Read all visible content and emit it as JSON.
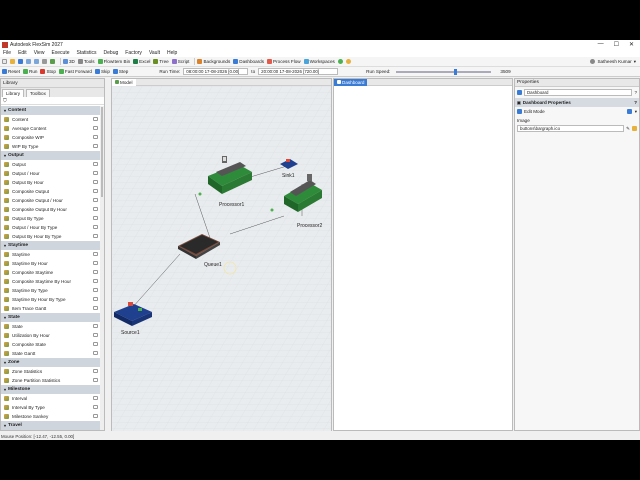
{
  "app": {
    "title": "Autodesk FlexSim 2027"
  },
  "window": {
    "minimize": "—",
    "maximize": "☐",
    "close": "✕"
  },
  "menu": [
    "File",
    "Edit",
    "View",
    "Execute",
    "Statistics",
    "Debug",
    "Factory",
    "Vault",
    "Help"
  ],
  "toolbar": {
    "items": [
      "3D",
      "Tools",
      "FlowItem Bin",
      "Excel",
      "Tree",
      "Script",
      "Backgrounds",
      "Dashboards",
      "Process Flow",
      "Workspaces"
    ],
    "user": "Satheesh Kumar"
  },
  "runbar": {
    "reset": "Reset",
    "run": "Run",
    "stop": "Stop",
    "fast_forward": "Fast Forward",
    "skip": "Skip",
    "step": "Step",
    "run_time_label": "Run Time:",
    "start_value": "08:00:00  17-08-2026  [0.00]",
    "to_label": "to",
    "end_value": "20:00:00  17-08-2026  [720.00]",
    "speed_label": "Run Speed:",
    "speed_value": "3509"
  },
  "library": {
    "title": "Library",
    "tabs": [
      "Library",
      "Toolbox"
    ],
    "filter_icon": "filter-icon",
    "categories": [
      {
        "name": "Content",
        "items": [
          "Content",
          "Average Content",
          "Composite WIP",
          "WIP By Type"
        ]
      },
      {
        "name": "Output",
        "items": [
          "Output",
          "Output / Hour",
          "Output By Hour",
          "Composite Output",
          "Composite Output / Hour",
          "Composite Output By Hour",
          "Output By Type",
          "Output / Hour By Type",
          "Output By Hour By Type"
        ]
      },
      {
        "name": "Staytime",
        "items": [
          "Staytime",
          "Staytime By Hour",
          "Composite Staytime",
          "Composite Staytime By Hour",
          "Staytime By Type",
          "Staytime By Hour By Type",
          "Item Trace Gantt"
        ]
      },
      {
        "name": "State",
        "items": [
          "State",
          "Utilization By Hour",
          "Composite State",
          "State Gantt"
        ]
      },
      {
        "name": "Zone",
        "items": [
          "Zone Statistics",
          "Zone Partition Statistics"
        ]
      },
      {
        "name": "Milestone",
        "items": [
          "Interval",
          "Interval By Type",
          "Milestone Sankey"
        ]
      },
      {
        "name": "Travel",
        "items": []
      }
    ]
  },
  "model": {
    "tab": "Model",
    "objects": {
      "source": "Source1",
      "queue": "Queue1",
      "processor1": "Processor1",
      "processor2": "Processor2",
      "sink": "Sink1"
    }
  },
  "dashboard": {
    "tab": "Dashboard"
  },
  "properties": {
    "title": "Properties",
    "object": "Dashboard",
    "section": "Dashboard Properties",
    "edit_mode_label": "Edit Mode",
    "image_label": "Image",
    "image_value": "buttons\\bargraph.ico"
  },
  "status": {
    "mouse_position": "Mouse Position: [-12.47, -12.55, 0.00]"
  },
  "colors": {
    "accent": "#3a7bd5",
    "category_bg": "#cfd5dd",
    "canvas_bg": "#e9ecef"
  }
}
